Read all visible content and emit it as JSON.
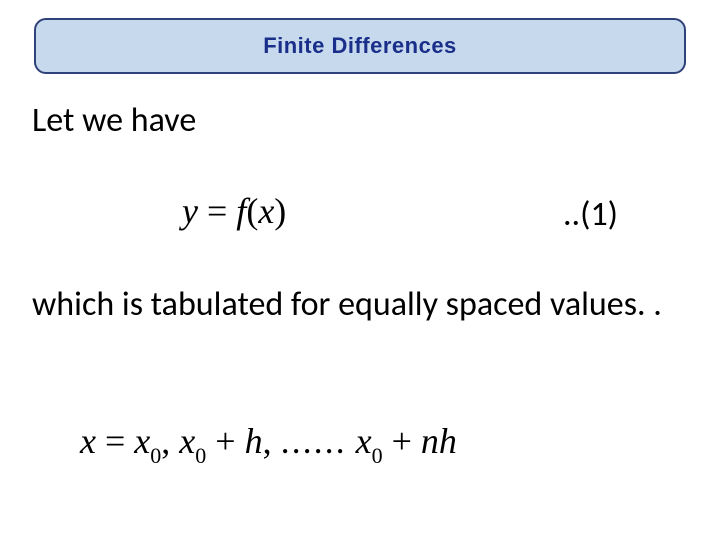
{
  "title": "Finite Differences",
  "intro": "Let we have",
  "equation1": {
    "lhs_var": "y",
    "eq_sign": " = ",
    "fn": "f",
    "open": "(",
    "arg": "x",
    "close": ")",
    "label": "..(1)"
  },
  "body": "which is tabulated for equally spaced values. .",
  "equation2": {
    "x": "x",
    "eq": " = ",
    "x0a": "x",
    "sub0a": "0",
    "comma1": ", ",
    "x0b": "x",
    "sub0b": "0",
    "plus1": " + ",
    "h1": "h",
    "comma2": ", ",
    "dots": "......",
    "x0c": "x",
    "sub0c": "0",
    "plus2": " + ",
    "n": "n",
    "h2": "h"
  }
}
